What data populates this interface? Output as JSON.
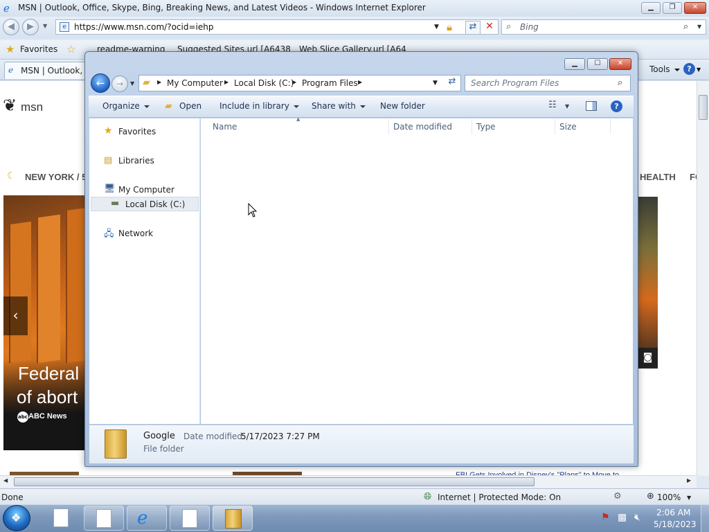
{
  "ie": {
    "window_title": "MSN | Outlook, Office, Skype, Bing, Breaking News, and Latest Videos - Windows Internet Explorer",
    "url": "https://www.msn.com/?ocid=iehp",
    "search_placeholder": "Bing",
    "favorites_label": "Favorites",
    "favorites_items": [
      "readme-warning",
      "Suggested Sites.url [A6438",
      "Web Slice Gallery.url [A64"
    ],
    "tab_label": "MSN | Outlook, O",
    "tools_label": "Tools",
    "status_text": "Done",
    "zone_text": "Internet | Protected Mode: On",
    "zoom_text": "100%"
  },
  "msn": {
    "logo": "msn",
    "nav_left": "NEW YORK / 5",
    "nav_right_1": "HEALTH",
    "nav_right_2": "FO",
    "headline_line1": "Federal",
    "headline_line2": "of abort",
    "source": "ABC News",
    "bottom_right_text": "FBI Gets Involved in Disney's \"Plans\" to Move to"
  },
  "explorer": {
    "breadcrumb": [
      "My Computer",
      "Local Disk (C:)",
      "Program Files"
    ],
    "search_placeholder": "Search Program Files",
    "toolbar": {
      "organize": "Organize",
      "open": "Open",
      "include_in_library": "Include in library",
      "share_with": "Share with",
      "new_folder": "New folder"
    },
    "nav": {
      "favorites": "Favorites",
      "libraries": "Libraries",
      "my_computer": "My Computer",
      "local_disk": "Local Disk (C:)",
      "network": "Network"
    },
    "columns": [
      "Name",
      "Date modified",
      "Type",
      "Size"
    ],
    "details": {
      "name": "Google",
      "date_label": "Date modified:",
      "date_value": "5/17/2023 7:27 PM",
      "type": "File folder"
    }
  },
  "taskbar": {
    "time": "2:06 AM",
    "date": "5/18/2023"
  },
  "colors": {
    "explorer_frame": "#b3c8e2",
    "taskbar": "#7d98bb",
    "ie_chrome": "#dbe6f2",
    "close_red": "#c9432a"
  }
}
